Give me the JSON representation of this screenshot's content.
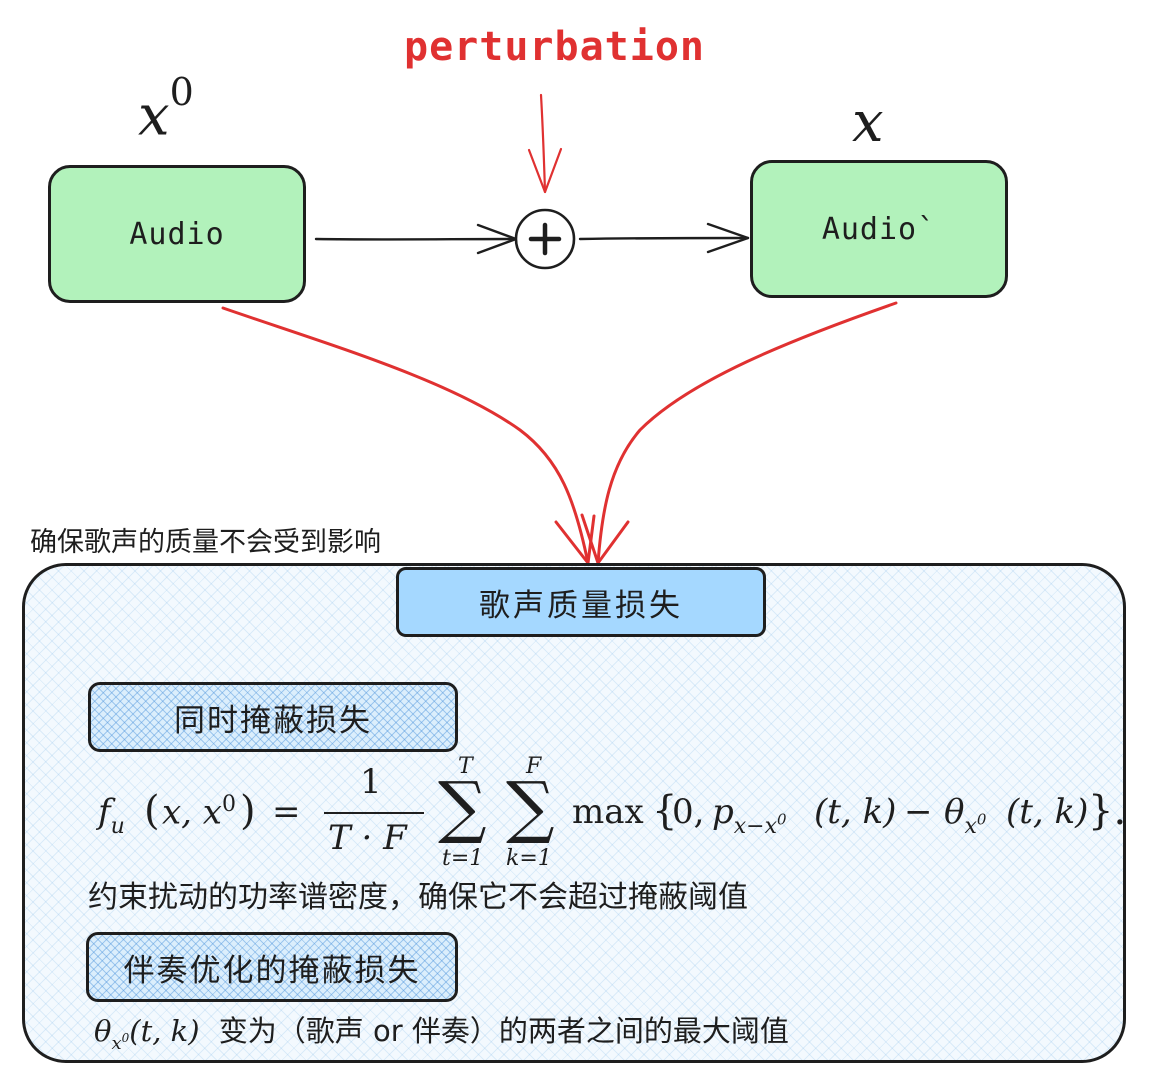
{
  "diagram": {
    "top_label": "perturbation",
    "input": {
      "variable": "x",
      "superscript": "0",
      "label": "Audio"
    },
    "output": {
      "variable": "x",
      "label": "Audio`"
    },
    "plus_symbol": "+",
    "side_note": "确保歌声的质量不会受到影响",
    "panel": {
      "title": "歌声质量损失",
      "section1": {
        "tag": "同时掩蔽损失",
        "description": "约束扰动的功率谱密度，确保它不会超过掩蔽阈值"
      },
      "section2": {
        "tag": "伴奏优化的掩蔽损失",
        "description": "变为（歌声 or 伴奏）的两者之间的最大阈值"
      }
    },
    "colors": {
      "node_fill": "#b2f2bb",
      "title_fill": "#a5d8ff",
      "accent_red": "#e03131",
      "panel_hatch": "#a5d8ff",
      "stroke": "#1e1e1e"
    }
  }
}
